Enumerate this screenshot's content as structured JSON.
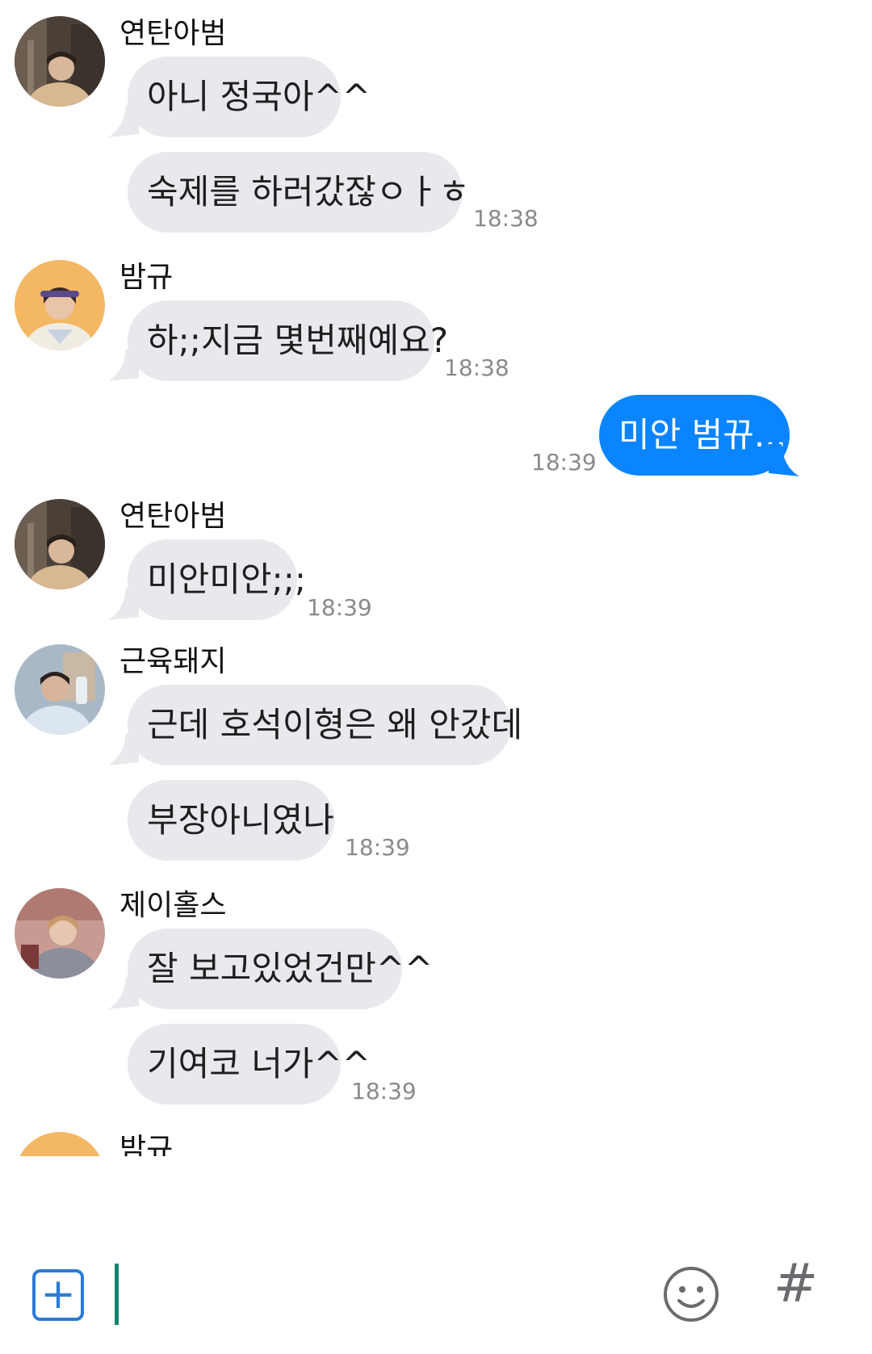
{
  "messages": [
    {
      "sender": "연탄아범",
      "avatar_icon": "avatar-photo-icon",
      "bubbles": [
        "아니 정국아^^",
        "숙제를 하러갔잖ㅇㅏㅎ"
      ],
      "time": "18:38"
    },
    {
      "sender": "밤규",
      "avatar_icon": "avatar-photo-icon",
      "bubbles": [
        "하;;지금 몇번째예요?"
      ],
      "time": "18:38"
    },
    {
      "sender": "me",
      "bubbles": [
        "미안 범뀨..."
      ],
      "time": "18:39"
    },
    {
      "sender": "연탄아범",
      "avatar_icon": "avatar-photo-icon",
      "bubbles": [
        "미안미안;;;"
      ],
      "time": "18:39"
    },
    {
      "sender": "근육돼지",
      "avatar_icon": "avatar-photo-icon",
      "bubbles": [
        "근데 호석이형은 왜 안갔데",
        "부장아니였나"
      ],
      "time": "18:39"
    },
    {
      "sender": "제이홀스",
      "avatar_icon": "avatar-photo-icon",
      "bubbles": [
        "잘 보고있었건만^^",
        "기여코 너가^^"
      ],
      "time": "18:39"
    },
    {
      "sender": "밤규",
      "avatar_icon": "avatar-photo-icon",
      "bubbles": [],
      "time": ""
    }
  ],
  "input_bar": {
    "plus_icon": "plus-square-icon",
    "plus_glyph": "+",
    "emoji_icon": "smiley-face-icon",
    "hash_icon": "hash-icon",
    "hash_glyph": "#",
    "value": ""
  },
  "colors": {
    "incoming_bubble": "#e8e8ed",
    "outgoing_bubble": "#0a84ff",
    "accent": "#2a7bd8",
    "cursor": "#14866d"
  }
}
